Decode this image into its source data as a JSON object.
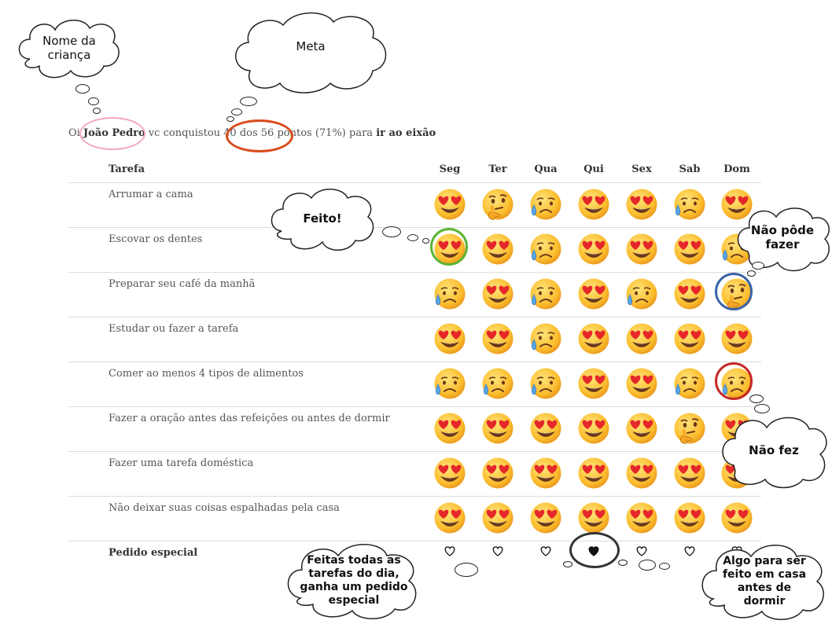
{
  "greeting": {
    "prefix": "Oi ",
    "name": "João Pedro",
    "middle": " vc conquistou ",
    "points": "40 dos 56",
    "suffix": " pontos (71%) para ",
    "goal": "ir ao eixão"
  },
  "table": {
    "task_header": "Tarefa",
    "days": [
      "Seg",
      "Ter",
      "Qua",
      "Qui",
      "Sex",
      "Sab",
      "Dom"
    ],
    "rows": [
      {
        "task": "Arrumar a cama",
        "marks": [
          "love",
          "think",
          "sad",
          "love",
          "love",
          "sad",
          "love"
        ]
      },
      {
        "task": "Escovar os dentes",
        "marks": [
          "love",
          "love",
          "sad",
          "love",
          "love",
          "love",
          "sad"
        ]
      },
      {
        "task": "Preparar seu café da manhã",
        "marks": [
          "sad",
          "love",
          "sad",
          "love",
          "sad",
          "love",
          "think"
        ]
      },
      {
        "task": "Estudar ou fazer a tarefa",
        "marks": [
          "love",
          "love",
          "sad",
          "love",
          "love",
          "love",
          "love"
        ]
      },
      {
        "task": "Comer ao menos 4 tipos de alimentos",
        "marks": [
          "sad",
          "sad",
          "sad",
          "love",
          "love",
          "sad",
          "sad"
        ]
      },
      {
        "task": "Fazer a oração antes das refeições ou antes de dormir",
        "marks": [
          "love",
          "love",
          "love",
          "love",
          "love",
          "think",
          "love"
        ]
      },
      {
        "task": "Fazer uma tarefa doméstica",
        "marks": [
          "love",
          "love",
          "love",
          "love",
          "love",
          "love",
          "love"
        ]
      },
      {
        "task": "Não deixar suas coisas espalhadas pela casa",
        "marks": [
          "love",
          "love",
          "love",
          "love",
          "love",
          "love",
          "love"
        ]
      }
    ],
    "special": {
      "label": "Pedido especial",
      "hearts": [
        "outline",
        "outline",
        "outline",
        "filled",
        "outline",
        "outline",
        "outline"
      ]
    }
  },
  "annotations": {
    "child_name": "Nome da\ncriança",
    "goal": "Meta",
    "done": "Feito!",
    "could_not": "Não pôde\nfazer",
    "did_not": "Não fez",
    "all_done": "Feitas todas as\ntarefas do dia,\nganha um pedido\nespecial",
    "special_request": "Algo para ser\nfeito em casa\nantes de\ndormir"
  },
  "icon_meanings": {
    "love": "heart-eyes-face",
    "think": "thinking-face",
    "sad": "sad-sweat-face"
  },
  "colors": {
    "name_ring": "#f4a6c8",
    "goal_ring": "#d94a1a",
    "done_ring": "#5cb335",
    "could_not_ring": "#3a63a8",
    "did_not_ring": "#c62828"
  }
}
